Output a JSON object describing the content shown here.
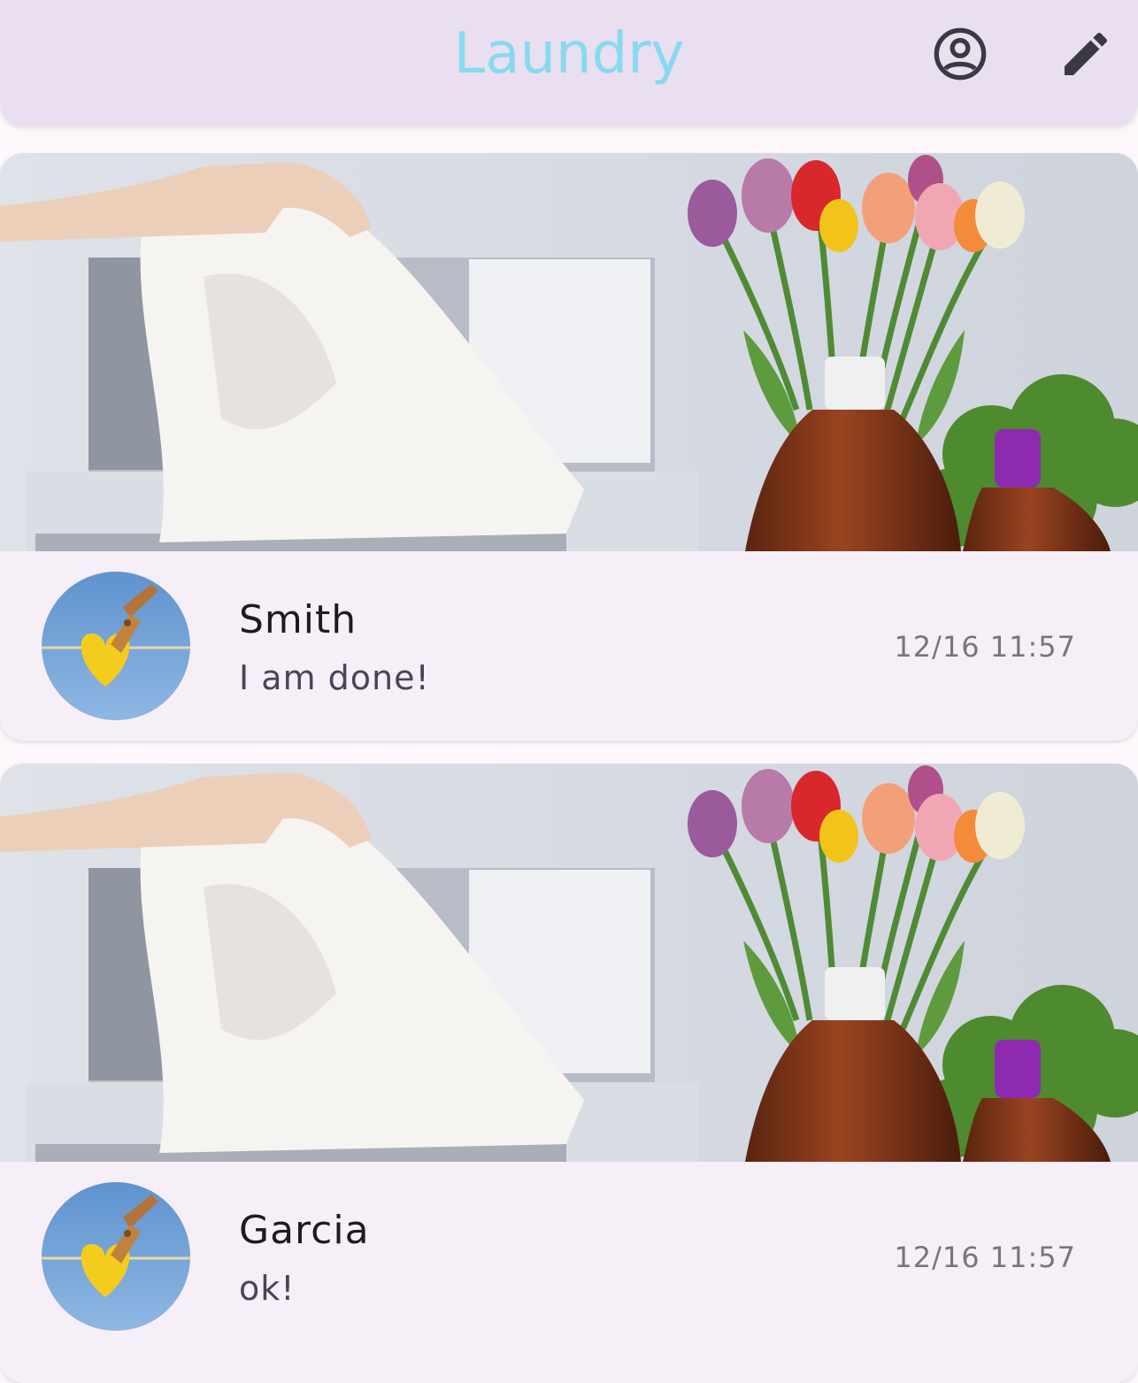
{
  "app_bar": {
    "title": "Laundry",
    "title_color": "#88d9ef",
    "profile_icon": "account-circle-icon",
    "edit_icon": "edit-pencil-icon"
  },
  "messages": [
    {
      "name": "Smith",
      "text": "I am done!",
      "time": "12/16 11:57",
      "avatar_icon": "clothespin-heart-avatar"
    },
    {
      "name": "Garcia",
      "text": "ok!",
      "time": "12/16 11:57",
      "avatar_icon": "clothespin-heart-avatar"
    }
  ]
}
